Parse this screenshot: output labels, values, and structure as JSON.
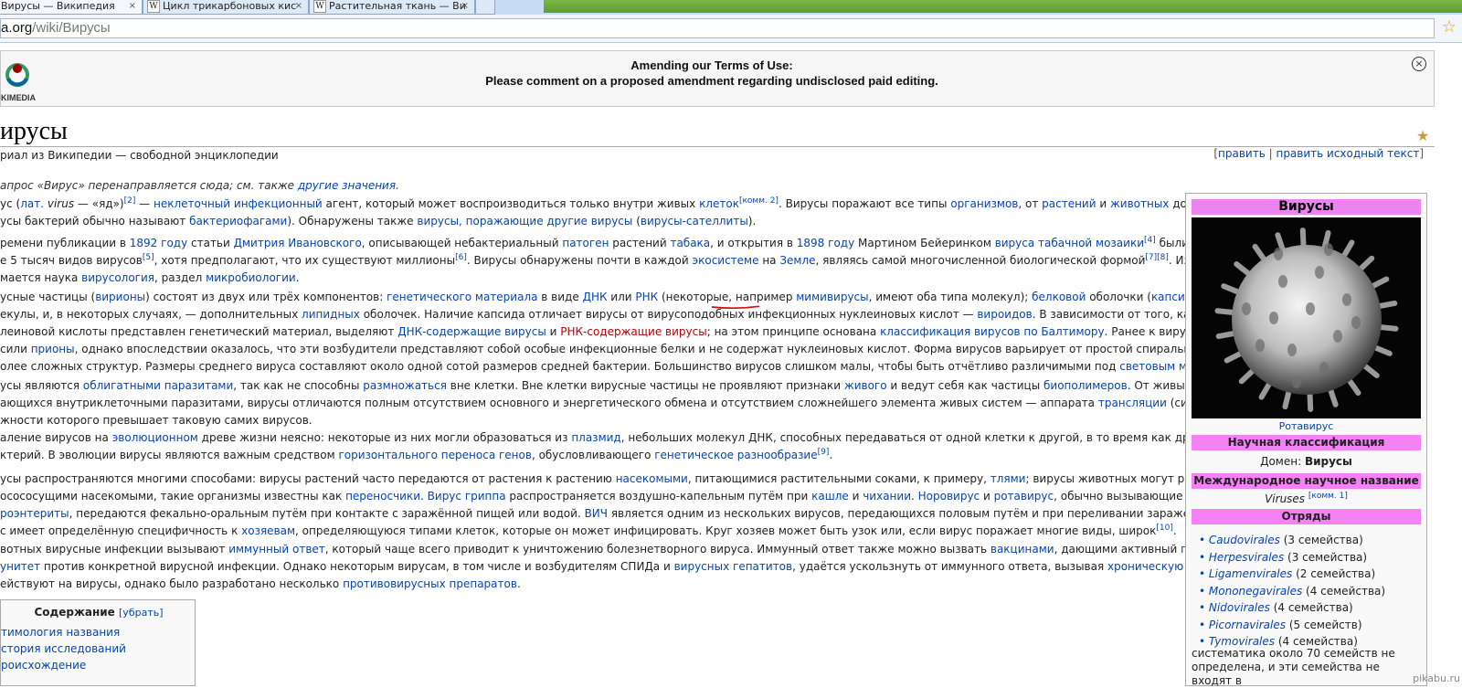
{
  "browser": {
    "tabs": [
      {
        "label": "Вирусы — Википедия",
        "icon": "wikipedia-icon"
      },
      {
        "label": "Цикл трикарбоновых кис",
        "icon": "wikipedia-icon"
      },
      {
        "label": "Растительная ткань — Ви",
        "icon": "wikipedia-icon"
      }
    ],
    "tab_close": "×",
    "address_domain": "a.org",
    "address_path": "/wiki/Вирусы",
    "star": "☆"
  },
  "banner": {
    "logo_text": "KIMEDIA",
    "line1": "Amending our Terms of Use:",
    "line2": "Please comment on a proposed amendment regarding undisclosed paid editing.",
    "close": "×"
  },
  "article": {
    "title": "ирусы",
    "subtitle": "риал из Википедии — свободной энциклопедии",
    "edit_links": {
      "open": "[",
      "edit": "править",
      "sep": " | ",
      "edit_source": "править исходный текст",
      "close": "]"
    },
    "hatnote": {
      "text": "апрос «Вирус» перенаправляется сюда; см. также ",
      "link": "другие значения",
      "end": "."
    }
  },
  "infobox": {
    "title": "Вирусы",
    "image_caption": "Ротавирус",
    "sci_class_header": "Научная классификация",
    "domain_label": "Домен: ",
    "domain_value": "Вирусы",
    "intl_name_header": "Международное научное название",
    "intl_name": "Viruses",
    "intl_note": "[комм. 1]",
    "orders_header": "Отряды",
    "orders": [
      {
        "name": "Caudovirales",
        "count": " (3 семейства)"
      },
      {
        "name": "Herpesvirales",
        "count": " (3 семейства)"
      },
      {
        "name": "Ligamenvirales",
        "count": " (2 семейства)"
      },
      {
        "name": "Mononegavirales",
        "count": " (4 семейства)"
      },
      {
        "name": "Nidovirales",
        "count": " (4 семейства)"
      },
      {
        "name": "Picornavirales",
        "count": " (5 семейств)"
      },
      {
        "name": "Tymovirales",
        "count": " (4 семейства)"
      }
    ],
    "note_line1": "систематика около 70 семейств не",
    "note_line2": "определена, и эти семейства не входят в"
  },
  "toc": {
    "title": "Содержание",
    "hide": "[убрать]",
    "items": [
      "тимология названия",
      "стория исследований",
      "роисхождение"
    ]
  },
  "watermark": "pikabu.ru"
}
